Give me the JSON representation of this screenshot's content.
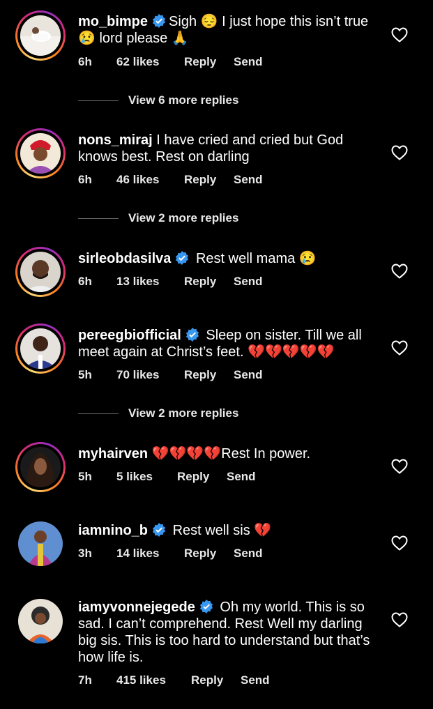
{
  "comments": [
    {
      "user": "mo_bimpe",
      "verified": true,
      "text": "Sigh 😔 I just hope this isn’t true 😢 lord please 🙏",
      "time": "6h",
      "likes": "62 likes",
      "reply": "Reply",
      "send": "Send",
      "more_replies": "View 6 more replies"
    },
    {
      "user": "nons_miraj",
      "verified": false,
      "text": "I have cried and cried but God knows best. Rest on darling",
      "time": "6h",
      "likes": "46 likes",
      "reply": "Reply",
      "send": "Send",
      "more_replies": "View 2 more replies"
    },
    {
      "user": "sirleobdasilva",
      "verified": true,
      "text": "Rest well mama 😢",
      "time": "6h",
      "likes": "13 likes",
      "reply": "Reply",
      "send": "Send"
    },
    {
      "user": "pereegbiofficial",
      "verified": true,
      "text": "Sleep on sister. Till we all meet again at Christ’s feet. 💔💔💔💔💔",
      "time": "5h",
      "likes": "70 likes",
      "reply": "Reply",
      "send": "Send",
      "more_replies": "View 2 more replies"
    },
    {
      "user": "myhairven",
      "verified": false,
      "text": "💔💔💔💔Rest In power.",
      "time": "5h",
      "likes": "5 likes",
      "reply": "Reply",
      "send": "Send"
    },
    {
      "user": "iamnino_b",
      "verified": true,
      "text": "Rest well sis 💔",
      "time": "3h",
      "likes": "14 likes",
      "reply": "Reply",
      "send": "Send"
    },
    {
      "user": "iamyvonnejegede",
      "verified": true,
      "text": "Oh my world. This is so sad. I can’t comprehend. Rest Well my darling big sis. This is too hard to understand but that’s how life is.",
      "time": "7h",
      "likes": "415 likes",
      "reply": "Reply",
      "send": "Send"
    }
  ],
  "colors": {
    "background": "#000000",
    "text": "#ffffff",
    "verified": "#3897f0"
  }
}
